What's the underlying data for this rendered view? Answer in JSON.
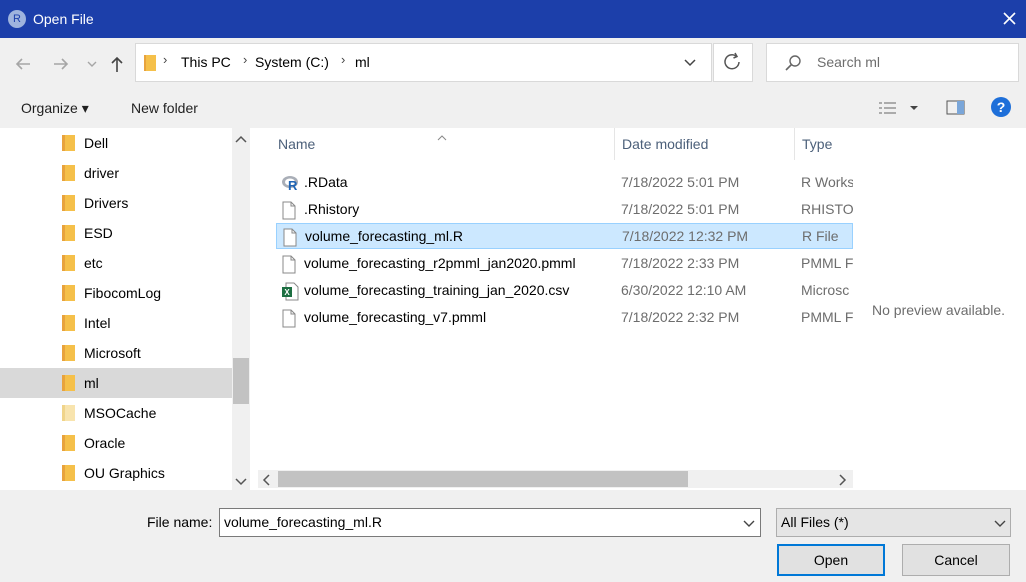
{
  "window": {
    "title": "Open File",
    "app_icon_letter": "R"
  },
  "address": {
    "crumbs": [
      "This PC",
      "System (C:)",
      "ml"
    ],
    "search_placeholder": "Search ml"
  },
  "toolbar": {
    "organize_label": "Organize ▾",
    "new_folder_label": "New folder"
  },
  "nav": {
    "items": [
      {
        "label": "Dell",
        "selected": false
      },
      {
        "label": "driver",
        "selected": false
      },
      {
        "label": "Drivers",
        "selected": false
      },
      {
        "label": "ESD",
        "selected": false
      },
      {
        "label": "etc",
        "selected": false
      },
      {
        "label": "FibocomLog",
        "selected": false
      },
      {
        "label": "Intel",
        "selected": false
      },
      {
        "label": "Microsoft",
        "selected": false
      },
      {
        "label": "ml",
        "selected": true
      },
      {
        "label": "MSOCache",
        "selected": false
      },
      {
        "label": "Oracle",
        "selected": false
      },
      {
        "label": "OU Graphics",
        "selected": false
      }
    ]
  },
  "files": {
    "columns": {
      "name": "Name",
      "date": "Date modified",
      "type": "Type"
    },
    "rows": [
      {
        "icon": "r-data-icon",
        "name": ".RData",
        "date": "7/18/2022 5:01 PM",
        "type": "R Works",
        "selected": false
      },
      {
        "icon": "blank-file-icon",
        "name": ".Rhistory",
        "date": "7/18/2022 5:01 PM",
        "type": "RHISTO",
        "selected": false
      },
      {
        "icon": "blank-file-icon",
        "name": "volume_forecasting_ml.R",
        "date": "7/18/2022 12:32 PM",
        "type": "R File",
        "selected": true
      },
      {
        "icon": "blank-file-icon",
        "name": "volume_forecasting_r2pmml_jan2020.pmml",
        "date": "7/18/2022 2:33 PM",
        "type": "PMML F",
        "selected": false
      },
      {
        "icon": "excel-file-icon",
        "name": "volume_forecasting_training_jan_2020.csv",
        "date": "6/30/2022 12:10 AM",
        "type": "Microsc",
        "selected": false
      },
      {
        "icon": "blank-file-icon",
        "name": "volume_forecasting_v7.pmml",
        "date": "7/18/2022 2:32 PM",
        "type": "PMML F",
        "selected": false
      }
    ]
  },
  "preview": {
    "message": "No preview available."
  },
  "bottom": {
    "file_name_label": "File name:",
    "file_name_value": "volume_forecasting_ml.R",
    "filter_value": "All Files  (*)",
    "open_label": "Open",
    "cancel_label": "Cancel"
  },
  "colors": {
    "titlebar": "#1c3faa",
    "selection": "#cce8ff",
    "folder": "#f5c04a",
    "help": "#1e6fd9"
  }
}
